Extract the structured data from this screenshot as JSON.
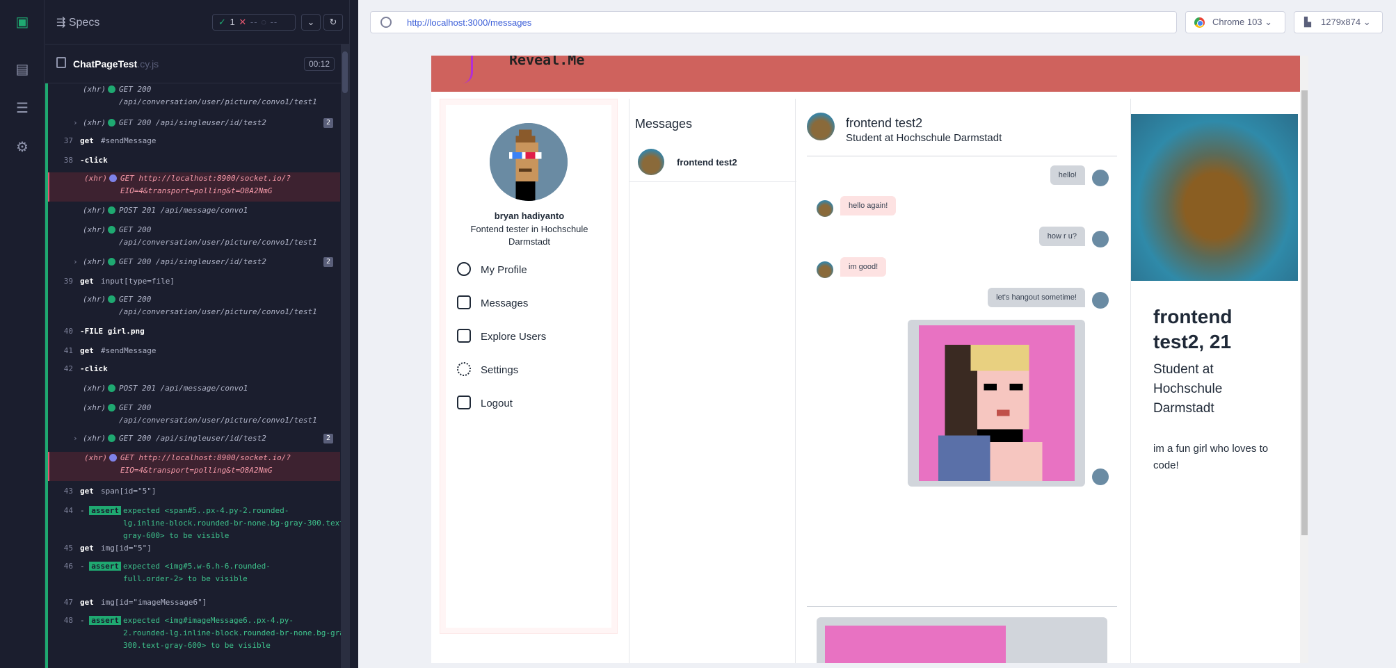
{
  "reporter": {
    "specs_label": "Specs",
    "passed": "1",
    "failed": "--",
    "pending": "--",
    "spec_name": "ChatPageTest",
    "spec_ext": ".cy.js",
    "duration": "00:12"
  },
  "log": [
    {
      "num": "",
      "kind": "xhr",
      "text": "GET 200\n/api/conversation/user/picture/convo1/test1"
    },
    {
      "num": "",
      "kind": "xhr",
      "text": "GET 200 /api/singleuser/id/test2",
      "badge": "2"
    },
    {
      "num": "37",
      "kind": "get",
      "text": "#sendMessage"
    },
    {
      "num": "38",
      "kind": "click",
      "text": "-click"
    },
    {
      "num": "",
      "kind": "xhr-err",
      "text": "GET http://localhost:8900/socket.io/?\nEIO=4&transport=polling&t=O8A2NmG"
    },
    {
      "num": "",
      "kind": "xhr",
      "text": "POST 201 /api/message/convo1"
    },
    {
      "num": "",
      "kind": "xhr",
      "text": "GET 200\n/api/conversation/user/picture/convo1/test1"
    },
    {
      "num": "",
      "kind": "xhr",
      "text": "GET 200 /api/singleuser/id/test2",
      "badge": "2"
    },
    {
      "num": "39",
      "kind": "get",
      "text": "input[type=file]"
    },
    {
      "num": "",
      "kind": "xhr",
      "text": "GET 200\n/api/conversation/user/picture/convo1/test1"
    },
    {
      "num": "40",
      "kind": "click",
      "text": "-FILE  girl.png"
    },
    {
      "num": "41",
      "kind": "get",
      "text": "#sendMessage"
    },
    {
      "num": "42",
      "kind": "click",
      "text": "-click"
    },
    {
      "num": "",
      "kind": "xhr",
      "text": "POST 201 /api/message/convo1"
    },
    {
      "num": "",
      "kind": "xhr",
      "text": "GET 200\n/api/conversation/user/picture/convo1/test1"
    },
    {
      "num": "",
      "kind": "xhr",
      "text": "GET 200 /api/singleuser/id/test2",
      "badge": "2"
    },
    {
      "num": "",
      "kind": "xhr-err",
      "text": "GET http://localhost:8900/socket.io/?\nEIO=4&transport=polling&t=O8A2NmG"
    },
    {
      "num": "43",
      "kind": "get",
      "text": "span[id=\"5\"]"
    },
    {
      "num": "44",
      "kind": "assert",
      "text": "expected <span#5..px-4.py-2.rounded-\nlg.inline-block.rounded-br-none.bg-gray-300.text-\ngray-600> to be visible"
    },
    {
      "num": "45",
      "kind": "get",
      "text": "img[id=\"5\"]"
    },
    {
      "num": "46",
      "kind": "assert",
      "text": "expected <img#5.w-6.h-6.rounded-\nfull.order-2> to be visible"
    },
    {
      "num": "47",
      "kind": "get",
      "text": "img[id=\"imageMessage6\"]"
    },
    {
      "num": "48",
      "kind": "assert",
      "text": "expected <img#imageMessage6..px-4.py-\n2.rounded-lg.inline-block.rounded-br-none.bg-gray-\n300.text-gray-600> to be visible"
    }
  ],
  "browser": {
    "url": "http://localhost:3000/messages",
    "browser_name": "Chrome 103",
    "viewport": "1279x874"
  },
  "app": {
    "brand": "Reveal.Me",
    "user_name": "bryan hadiyanto",
    "user_desc": "Fontend tester in Hochschule Darmstadt",
    "nav": [
      "My Profile",
      "Messages",
      "Explore Users",
      "Settings",
      "Logout"
    ],
    "messages_title": "Messages",
    "contact_name": "frontend test2",
    "chat_name": "frontend test2",
    "chat_desc": "Student at Hochschule Darmstadt",
    "messages": [
      {
        "from": "me",
        "text": "hello!"
      },
      {
        "from": "them",
        "text": "hello again!"
      },
      {
        "from": "me",
        "text": "how r u?"
      },
      {
        "from": "them",
        "text": "im good!"
      },
      {
        "from": "me",
        "text": "let's hangout sometime!"
      }
    ],
    "profile_name": "frontend test2, 21",
    "profile_desc": "Student at Hochschule Darmstadt",
    "profile_bio": "im a fun girl who loves to code!"
  }
}
